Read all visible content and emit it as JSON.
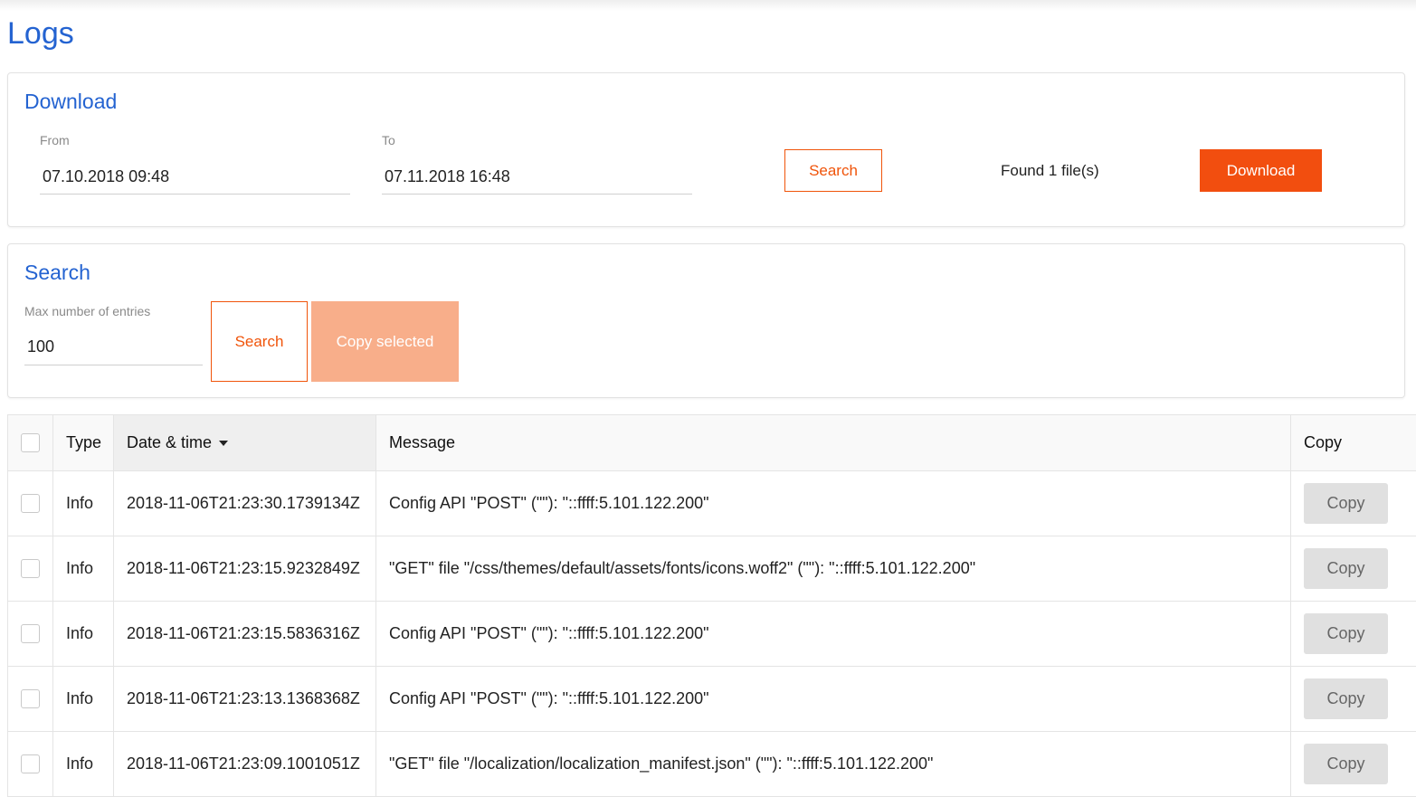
{
  "page": {
    "title": "Logs"
  },
  "download": {
    "title": "Download",
    "from_label": "From",
    "from_value": "07.10.2018 09:48",
    "to_label": "To",
    "to_value": "07.11.2018 16:48",
    "search_label": "Search",
    "found_text": "Found 1 file(s)",
    "download_label": "Download"
  },
  "search": {
    "title": "Search",
    "max_label": "Max number of entries",
    "max_value": "100",
    "search_label": "Search",
    "copy_selected_label": "Copy selected"
  },
  "table": {
    "headers": {
      "type": "Type",
      "datetime": "Date & time",
      "message": "Message",
      "copy": "Copy"
    },
    "rows": [
      {
        "type": "Info",
        "datetime": "2018-11-06T21:23:30.1739134Z",
        "message": "Config API \"POST\" (\"\"): \"::ffff:5.101.122.200\"",
        "copy": "Copy"
      },
      {
        "type": "Info",
        "datetime": "2018-11-06T21:23:15.9232849Z",
        "message": "\"GET\" file \"/css/themes/default/assets/fonts/icons.woff2\" (\"\"): \"::ffff:5.101.122.200\"",
        "copy": "Copy"
      },
      {
        "type": "Info",
        "datetime": "2018-11-06T21:23:15.5836316Z",
        "message": "Config API \"POST\" (\"\"): \"::ffff:5.101.122.200\"",
        "copy": "Copy"
      },
      {
        "type": "Info",
        "datetime": "2018-11-06T21:23:13.1368368Z",
        "message": "Config API \"POST\" (\"\"): \"::ffff:5.101.122.200\"",
        "copy": "Copy"
      },
      {
        "type": "Info",
        "datetime": "2018-11-06T21:23:09.1001051Z",
        "message": "\"GET\" file \"/localization/localization_manifest.json\" (\"\"): \"::ffff:5.101.122.200\"",
        "copy": "Copy"
      }
    ]
  },
  "colors": {
    "accent": "#2463d1",
    "brand": "#f24e0f",
    "brand_light": "#f8ae8a"
  }
}
